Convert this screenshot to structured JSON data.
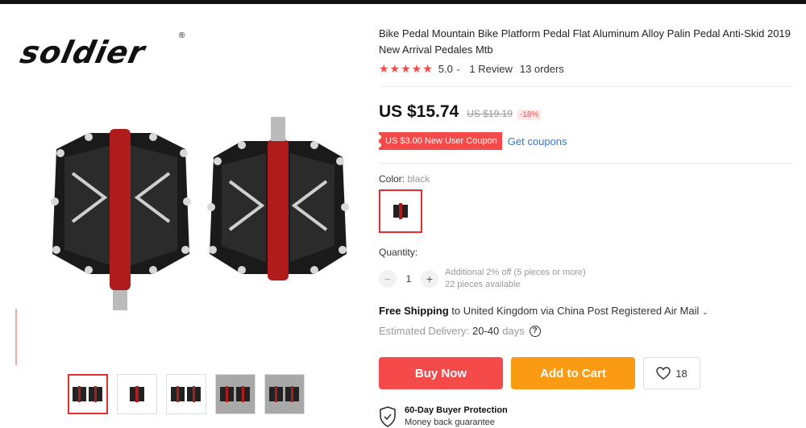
{
  "brand": {
    "logo_text": "soldier",
    "registered": "®"
  },
  "product": {
    "title": "Bike Pedal Mountain Bike Platform Pedal Flat Aluminum Alloy Palin Pedal Anti-Skid 2019 New Arrival Pedales Mtb",
    "rating": {
      "stars": "★★★★★",
      "value": "5.0",
      "reviews": "1 Review",
      "orders": "13 orders"
    },
    "price": {
      "current": "US $15.74",
      "original": "US $19.19",
      "discount": "-18%"
    },
    "coupon": {
      "label": "US $3.00 New User Coupon",
      "link": "Get coupons"
    },
    "color": {
      "label": "Color:",
      "value": "black"
    },
    "quantity": {
      "label": "Quantity:",
      "value": "1",
      "minus": "−",
      "plus": "+",
      "offer": "Additional 2% off (5 pieces or more)",
      "available": "22 pieces available"
    },
    "shipping": {
      "free_label": "Free Shipping",
      "destination": "to United Kingdom via China Post Registered Air Mail",
      "delivery_label": "Estimated Delivery:",
      "delivery_value": "20-40",
      "delivery_unit": "days"
    },
    "actions": {
      "buy_now": "Buy Now",
      "add_to_cart": "Add to Cart",
      "wishlist_count": "18"
    },
    "protection": {
      "title": "60-Day Buyer Protection",
      "subtitle": "Money back guarantee"
    }
  },
  "gallery": {
    "thumbnail_count": 5,
    "accent": "#e62e2e"
  },
  "colors": {
    "primary": "#f44a4a",
    "cart": "#fa9b13",
    "link": "#2a7bd5"
  }
}
